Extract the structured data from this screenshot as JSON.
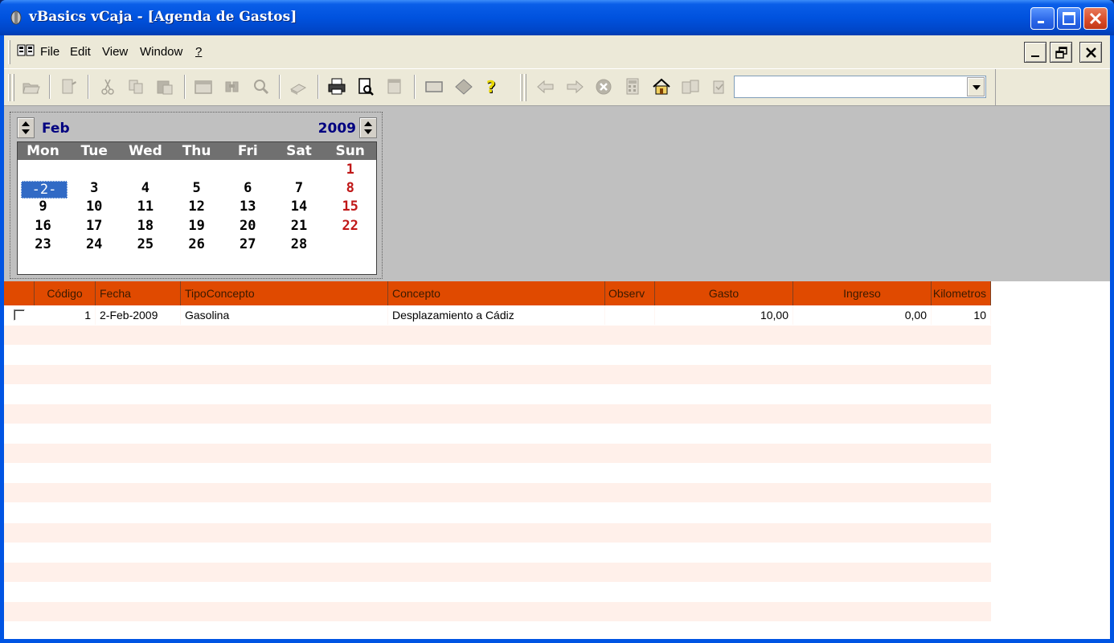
{
  "window": {
    "title": "vBasics vCaja - [Agenda de Gastos]"
  },
  "menu": {
    "items": [
      {
        "label": "File",
        "accel": "F"
      },
      {
        "label": "Edit",
        "accel": "E"
      },
      {
        "label": "View",
        "accel": "V"
      },
      {
        "label": "Window",
        "accel": "W"
      },
      {
        "label": "?",
        "accel": "?"
      }
    ]
  },
  "toolbar": {
    "combo_value": ""
  },
  "calendar": {
    "month": "Feb",
    "year": "2009",
    "weekdays": [
      "Mon",
      "Tue",
      "Wed",
      "Thu",
      "Fri",
      "Sat",
      "Sun"
    ],
    "weeks": [
      [
        "",
        "",
        "",
        "",
        "",
        "",
        "1"
      ],
      [
        "-2-",
        "3",
        "4",
        "5",
        "6",
        "7",
        "8"
      ],
      [
        "9",
        "10",
        "11",
        "12",
        "13",
        "14",
        "15"
      ],
      [
        "16",
        "17",
        "18",
        "19",
        "20",
        "21",
        "22"
      ],
      [
        "23",
        "24",
        "25",
        "26",
        "27",
        "28",
        ""
      ]
    ],
    "selected_day": "-2-"
  },
  "grid": {
    "columns": [
      "",
      "Código",
      "Fecha",
      "TipoConcepto",
      "Concepto",
      "Observ",
      "Gasto",
      "Ingreso",
      "Kilometros"
    ],
    "rows": [
      {
        "checked": false,
        "codigo": "1",
        "fecha": "2-Feb-2009",
        "tipo": "Gasolina",
        "concepto": "Desplazamiento a Cádiz",
        "observ": "",
        "gasto": "10,00",
        "ingreso": "0,00",
        "km": "10"
      }
    ]
  },
  "colors": {
    "header_bg": "#e04a00",
    "alt_row": "#fff0ea",
    "sunday": "#c01818",
    "month_text": "#000080"
  }
}
